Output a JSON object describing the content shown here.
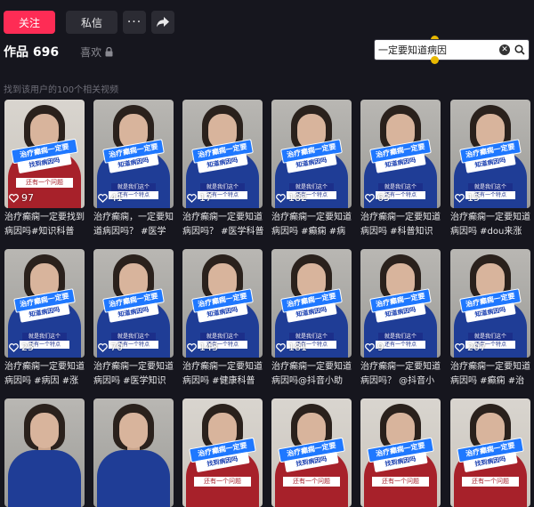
{
  "header": {
    "follow_label": "关注",
    "message_label": "私信",
    "more_label": "···",
    "share_icon": "share-arrow-icon"
  },
  "tabs": {
    "works_label": "作品 696",
    "likes_label": "喜欢",
    "likes_icon": "lock-icon"
  },
  "search": {
    "query": "一定要知道病因",
    "clear_icon": "clear-icon",
    "search_icon": "search-icon"
  },
  "results": {
    "summary": "找到该用户的100个相关视频"
  },
  "videos": [
    {
      "likes": "97",
      "title": "治疗癫痫一定要找到病因吗#知识科普 #...",
      "caption1": "治疗癫痫一定要",
      "caption2": "找到病因吗",
      "sub1": "还有一个问题",
      "sub2": "",
      "style": "red"
    },
    {
      "likes": "41",
      "title": "治疗癫痫，一定要知道病因吗？ #医学科...",
      "caption1": "治疗癫痫一定要",
      "caption2": "知道病因吗",
      "sub1": "就是我们这个",
      "sub2": "还有一个特点",
      "style": "blue"
    },
    {
      "likes": "17",
      "title": "治疗癫痫一定要知道病因吗？ #医学科普 ...",
      "caption1": "治疗癫痫一定要",
      "caption2": "知道病因吗",
      "sub1": "就是我们这个",
      "sub2": "还有一个特点",
      "style": "blue"
    },
    {
      "likes": "182",
      "title": "治疗癫痫一定要知道病因吗 #癫痫 #病因...",
      "caption1": "治疗癫痫一定要",
      "caption2": "知道病因吗",
      "sub1": "就是我们这个",
      "sub2": "还有一个特点",
      "style": "blue"
    },
    {
      "likes": "63",
      "title": "治疗癫痫一定要知道病因吗 #科普知识 #...",
      "caption1": "治疗癫痫一定要",
      "caption2": "知道病因吗",
      "sub1": "就是我们这个",
      "sub2": "还有一个特点",
      "style": "blue"
    },
    {
      "likes": "15",
      "title": "治疗癫痫一定要知道病因吗 #dou来涨健...",
      "caption1": "治疗癫痫一定要",
      "caption2": "知道病因吗",
      "sub1": "就是我们这个",
      "sub2": "还有一个特点",
      "style": "blue"
    },
    {
      "likes": "25",
      "title": "治疗癫痫一定要知道病因吗 #病因 #涨知...",
      "caption1": "治疗癫痫一定要",
      "caption2": "知道病因吗",
      "sub1": "就是我们这个",
      "sub2": "还有一个特点",
      "style": "blue"
    },
    {
      "likes": "70",
      "title": "治疗癫痫一定要知道病因吗 #医学知识 #...",
      "caption1": "治疗癫痫一定要",
      "caption2": "知道病因吗",
      "sub1": "就是我们这个",
      "sub2": "还有一个特点",
      "style": "blue"
    },
    {
      "likes": "143",
      "title": "治疗癫痫一定要知道病因吗 #健康科普 @...",
      "caption1": "治疗癫痫一定要",
      "caption2": "知道病因吗",
      "sub1": "就是我们这个",
      "sub2": "还有一个特点",
      "style": "blue"
    },
    {
      "likes": "181",
      "title": "治疗癫痫一定要知道病因吗@抖音小助手...",
      "caption1": "治疗癫痫一定要",
      "caption2": "知道病因吗",
      "sub1": "就是我们这个",
      "sub2": "还有一个特点",
      "style": "blue"
    },
    {
      "likes": "9",
      "title": "治疗癫痫一定要知道病因吗？ @抖音小助...",
      "caption1": "治疗癫痫一定要",
      "caption2": "知道病因吗",
      "sub1": "就是我们这个",
      "sub2": "还有一个特点",
      "style": "blue"
    },
    {
      "likes": "207",
      "title": "治疗癫痫一定要知道病因吗 #癫痫 #治疗...",
      "caption1": "治疗癫痫一定要",
      "caption2": "知道病因吗",
      "sub1": "就是我们这个",
      "sub2": "还有一个特点",
      "style": "blue"
    },
    {
      "likes": "",
      "title": "",
      "caption1": "",
      "caption2": "",
      "sub1": "",
      "sub2": "",
      "style": "blue-plain"
    },
    {
      "likes": "",
      "title": "",
      "caption1": "",
      "caption2": "",
      "sub1": "",
      "sub2": "",
      "style": "blue-plain"
    },
    {
      "likes": "",
      "title": "",
      "caption1": "治疗癫痫一定要",
      "caption2": "找到病因吗",
      "sub1": "还有一个问题",
      "sub2": "",
      "style": "red"
    },
    {
      "likes": "",
      "title": "",
      "caption1": "治疗癫痫一定要",
      "caption2": "找到病因吗",
      "sub1": "还有一个问题",
      "sub2": "",
      "style": "red"
    },
    {
      "likes": "",
      "title": "",
      "caption1": "治疗癫痫一定要",
      "caption2": "找到病因吗",
      "sub1": "还有一个问题",
      "sub2": "",
      "style": "red"
    },
    {
      "likes": "",
      "title": "",
      "caption1": "治疗癫痫一定要",
      "caption2": "找到病因吗",
      "sub1": "还有一个问题",
      "sub2": "",
      "style": "red"
    }
  ]
}
